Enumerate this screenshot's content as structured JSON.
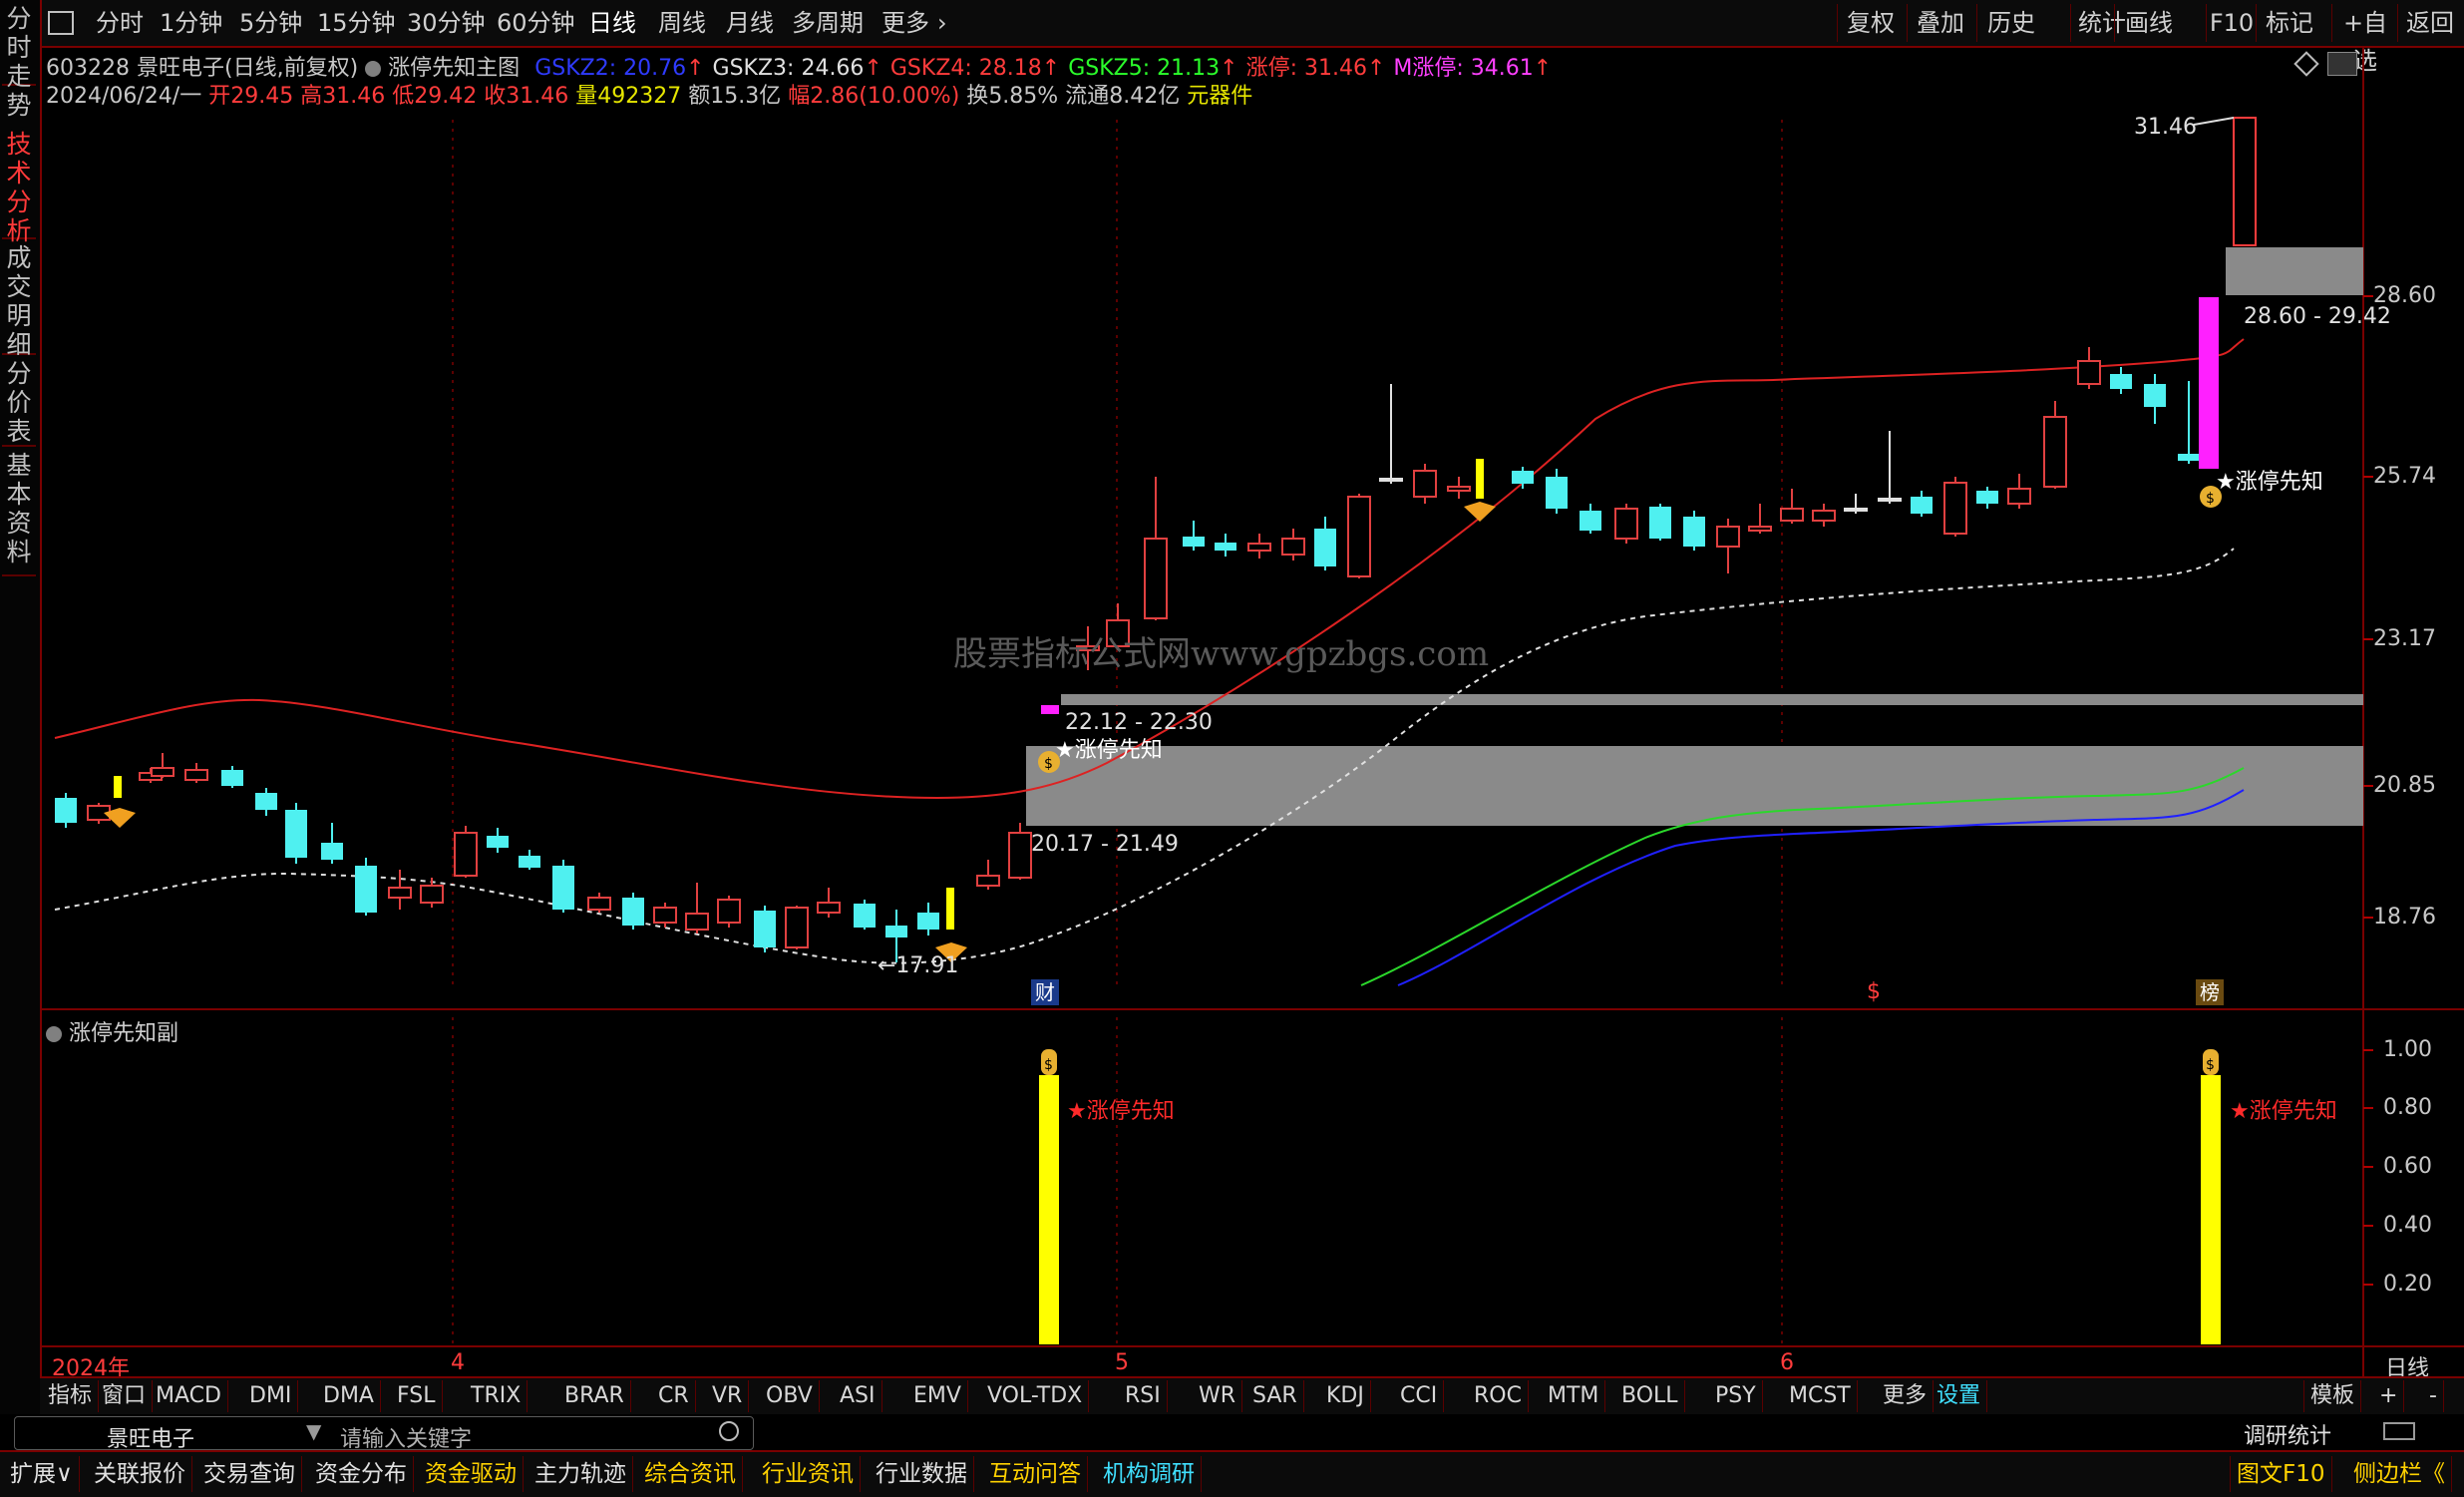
{
  "toolbar": {
    "periods": [
      "分时",
      "1分钟",
      "5分钟",
      "15分钟",
      "30分钟",
      "60分钟",
      "日线",
      "周线",
      "月线",
      "多周期",
      "更多"
    ],
    "active_period": "日线",
    "right_buttons": [
      "复权",
      "叠加",
      "历史",
      "统计",
      "画线",
      "F10",
      "标记",
      "+自选",
      "返回"
    ]
  },
  "left_tabs": [
    {
      "label": "分时走势",
      "active": false
    },
    {
      "label": "技术分析",
      "active": true
    },
    {
      "label": "成交明细",
      "active": false
    },
    {
      "label": "分价表",
      "active": false
    },
    {
      "label": "基本资料",
      "active": false
    }
  ],
  "header": {
    "code": "603228",
    "name": "景旺电子",
    "mode": "(日线,前复权)",
    "indicator_name": "涨停先知主图",
    "lines": [
      {
        "label": "GSKZ2:",
        "value": "20.76",
        "color": "#2f3bff",
        "arrow": "↑"
      },
      {
        "label": "GSKZ3:",
        "value": "24.66",
        "color": "#e0e0e0",
        "arrow": "↑"
      },
      {
        "label": "GSKZ4:",
        "value": "28.18",
        "color": "#ff3c3c",
        "arrow": "↑"
      },
      {
        "label": "GSKZ5:",
        "value": "21.13",
        "color": "#2bff2b",
        "arrow": "↑"
      },
      {
        "label": "涨停:",
        "value": "31.46",
        "color": "#ff3c3c",
        "arrow": "↑"
      },
      {
        "label": "M涨停:",
        "value": "34.61",
        "color": "#ff40ff",
        "arrow": "↑"
      }
    ],
    "quote": {
      "date": "2024/06/24/一",
      "open_label": "开",
      "open": "29.45",
      "high_label": "高",
      "high": "31.46",
      "low_label": "低",
      "low": "29.42",
      "close_label": "收",
      "close": "31.46",
      "vol_label": "量",
      "vol": "492327",
      "amount_label": "额",
      "amount": "15.3亿",
      "chg_label": "幅",
      "chg": "2.86(10.00%)",
      "turnover_label": "换",
      "turnover": "5.85%",
      "float_label": "流通",
      "float": "8.42亿",
      "sector": "元器件"
    }
  },
  "main_chart": {
    "price_axis": [
      "28.60",
      "25.74",
      "23.17",
      "20.85",
      "18.76"
    ],
    "date_labels": [
      "2024年",
      "4",
      "5",
      "6"
    ],
    "annotations": {
      "high_price": "31.46",
      "low_price": "←17.91",
      "zone_top": "28.60 - 29.42",
      "zone_mid": "22.12 - 22.30",
      "zone_low": "20.17 - 21.49",
      "signal_text": "★涨停先知",
      "badge_cai": "财",
      "badge_bang": "榜",
      "badge_dollar": "$"
    },
    "watermark": "股票指标公式网www.gpzbgs.com"
  },
  "sub_chart": {
    "title": "涨停先知副",
    "axis": [
      "1.00",
      "0.80",
      "0.60",
      "0.40",
      "0.20"
    ],
    "signal_text": "★涨停先知"
  },
  "indicator_tabs": [
    "指标",
    "窗口",
    "MACD",
    "DMI",
    "DMA",
    "FSL",
    "TRIX",
    "BRAR",
    "CR",
    "VR",
    "OBV",
    "ASI",
    "EMV",
    "VOL-TDX",
    "RSI",
    "WR",
    "SAR",
    "KDJ",
    "CCI",
    "ROC",
    "MTM",
    "BOLL",
    "PSY",
    "MCST",
    "更多",
    "设置"
  ],
  "right_controls": {
    "template": "模板",
    "plus": "+",
    "minus": "-",
    "daily_side": "日线"
  },
  "search": {
    "stock": "景旺电子",
    "placeholder": "请输入关键字",
    "research": "调研统计"
  },
  "status_tabs": [
    "扩展∨",
    "关联报价",
    "交易查询",
    "资金分布",
    "资金驱动",
    "主力轨迹",
    "综合资讯",
    "行业资讯",
    "行业数据",
    "互动问答",
    "机构调研"
  ],
  "status_right": [
    "图文F10",
    "侧边栏《"
  ]
}
